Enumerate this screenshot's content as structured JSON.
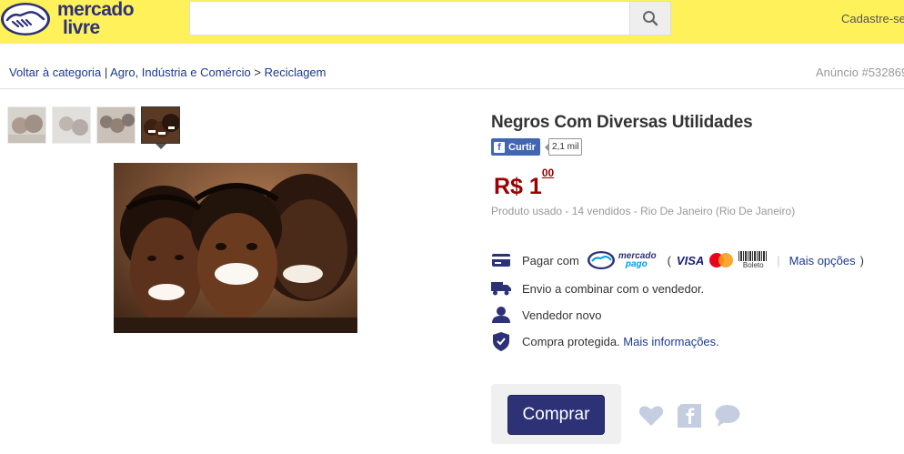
{
  "header": {
    "logo_line1": "mercado",
    "logo_line2": "livre",
    "search_placeholder": "",
    "cadastre_label": "Cadastre-se"
  },
  "breadcrumb": {
    "back_label": "Voltar à categoria",
    "separator": "|",
    "category": "Agro, Indústria e Comércio",
    "arrow": ">",
    "subcategory": "Reciclagem"
  },
  "anuncio": "Anúncio #532869",
  "product": {
    "title": "Negros Com Diversas Utilidades",
    "fb_like_label": "Curtir",
    "fb_count": "2,1 mil",
    "price_main": "R$ 1",
    "price_cents": "00",
    "condition": "Produto usado",
    "sold": "14 vendidos",
    "location": "Rio De Janeiro (Rio De Janeiro)",
    "meta_sep": " - "
  },
  "payment": {
    "pay_with": "Pagar com",
    "mp_line1": "mercado",
    "mp_line2": "pago",
    "open_paren": "(",
    "visa": "VISA",
    "boleto": "Boleto",
    "pipe": "|",
    "more_options": "Mais opções",
    "close_paren": ")"
  },
  "shipping": "Envio a combinar com o vendedor.",
  "seller": "Vendedor novo",
  "protection": {
    "text": "Compra protegida.",
    "link": "Mais informações."
  },
  "buy_button": "Comprar",
  "colors": {
    "header_bg": "#fff159",
    "brand_blue": "#2d3277",
    "price_red": "#990000",
    "link_blue": "#1c3b8e"
  },
  "icons": [
    "handshake-logo-icon",
    "search-icon",
    "credit-card-icon",
    "truck-icon",
    "user-icon",
    "shield-check-icon",
    "heart-icon",
    "facebook-share-icon",
    "speech-bubble-icon"
  ]
}
